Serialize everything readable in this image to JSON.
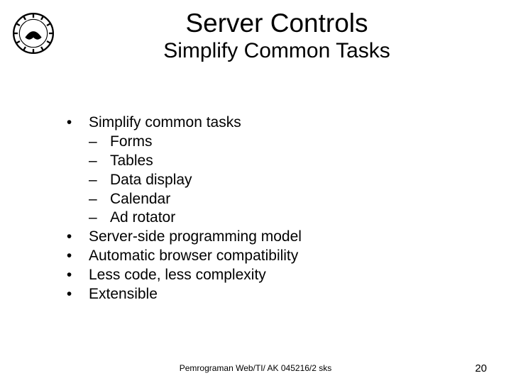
{
  "header": {
    "title": "Server Controls",
    "subtitle": "Simplify Common Tasks"
  },
  "bullets": {
    "b0": "Simplify common tasks",
    "b0_subs": {
      "s0": "Forms",
      "s1": "Tables",
      "s2": "Data display",
      "s3": "Calendar",
      "s4": "Ad rotator"
    },
    "b1": "Server-side programming model",
    "b2": "Automatic browser compatibility",
    "b3": "Less code, less complexity",
    "b4": "Extensible"
  },
  "footer": {
    "text": "Pemrograman Web/TI/ AK 045216/2 sks",
    "page": "20"
  }
}
